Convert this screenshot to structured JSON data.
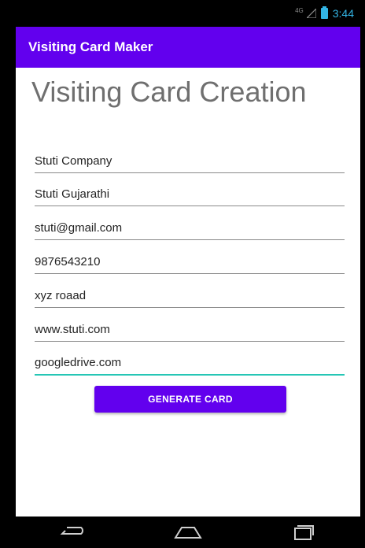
{
  "statusbar": {
    "network": "4G",
    "time": "3:44"
  },
  "appbar": {
    "title": "Visiting Card Maker"
  },
  "main": {
    "heading": "Visiting Card Creation",
    "fields": [
      {
        "name": "company-name-field",
        "value": "Stuti Company"
      },
      {
        "name": "person-name-field",
        "value": "Stuti Gujarathi"
      },
      {
        "name": "email-field",
        "value": "stuti@gmail.com"
      },
      {
        "name": "phone-field",
        "value": "9876543210"
      },
      {
        "name": "address-field",
        "value": "xyz roaad"
      },
      {
        "name": "website-field",
        "value": "www.stuti.com"
      },
      {
        "name": "drive-link-field",
        "value": "googledrive.com"
      }
    ],
    "generate_button_label": "GENERATE CARD"
  },
  "navbar": {
    "icons": [
      "back-icon",
      "home-icon",
      "recents-icon"
    ]
  },
  "colors": {
    "primary": "#6200ee",
    "accent_underline": "#26c6b5",
    "status_blue": "#33b5e5"
  }
}
